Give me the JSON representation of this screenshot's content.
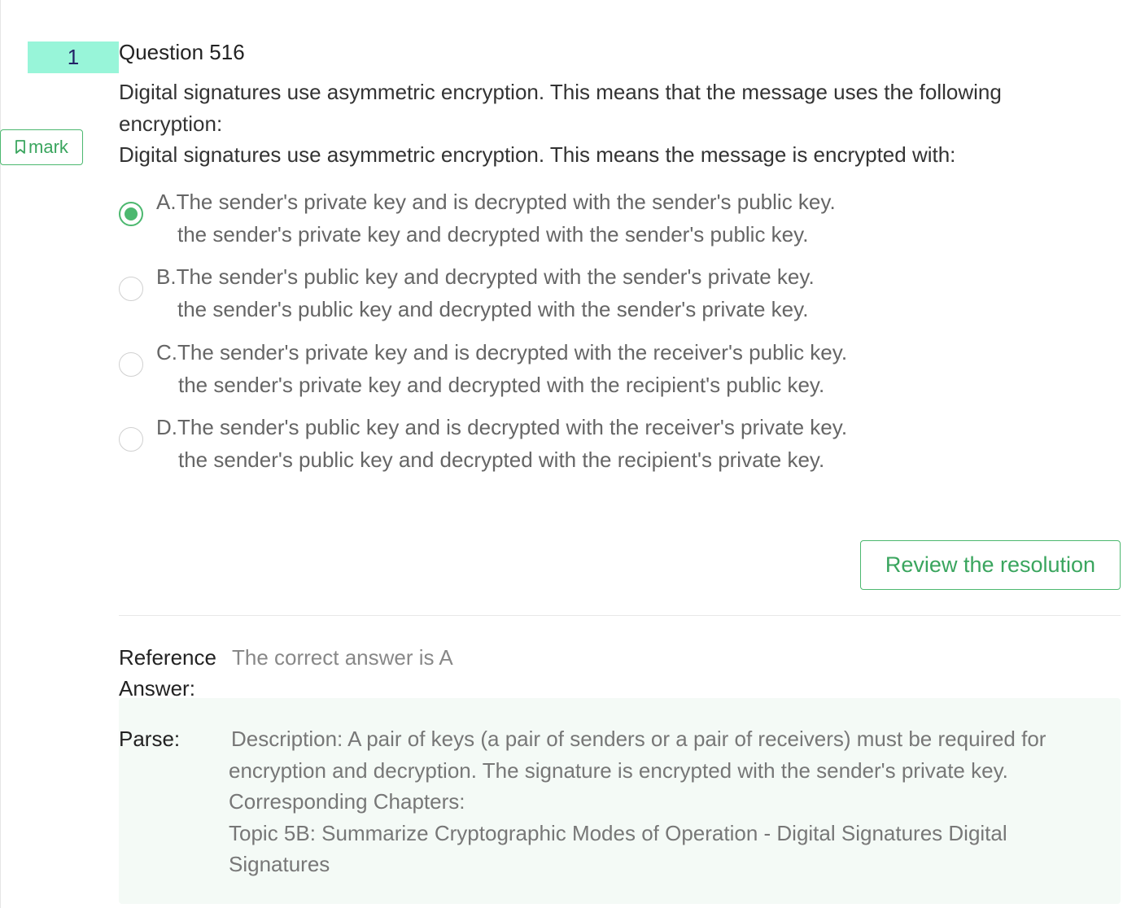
{
  "question": {
    "number": "1",
    "title": "Question 516",
    "stem_lines": [
      "Digital signatures use asymmetric encryption. This means that the message uses the following encryption:",
      "Digital signatures use asymmetric encryption. This means the message is encrypted with:"
    ]
  },
  "mark_button": {
    "label": "mark",
    "icon": "bookmark-icon"
  },
  "options": [
    {
      "letter": "A.",
      "text": "The sender's private key and is decrypted with the sender's public key.",
      "alt_text": "the sender's private key and decrypted with the sender's public key.",
      "selected": true
    },
    {
      "letter": "B.",
      "text": "The sender's public key and decrypted with the sender's private key.",
      "alt_text": "the sender's public key and decrypted with the sender's private key.",
      "selected": false
    },
    {
      "letter": "C.",
      "text": "The sender's private key and is decrypted with the receiver's public key.",
      "alt_text": "the sender's private key and decrypted with the recipient's public key.",
      "selected": false
    },
    {
      "letter": "D.",
      "text": "The sender's public key and is decrypted with the receiver's private key.",
      "alt_text": "the sender's public key and decrypted with the recipient's private key.",
      "selected": false
    }
  ],
  "review_button": {
    "label": "Review the resolution"
  },
  "reference": {
    "label_line1": "Reference",
    "label_line2": "Answer:",
    "value": "The correct answer is A"
  },
  "parse": {
    "label": "Parse:",
    "lines": [
      "Description: A pair of keys (a pair of senders or a pair of receivers) must be required for encryption and decryption. The signature is encrypted with the sender's private key.",
      "Corresponding Chapters:",
      "Topic 5B: Summarize Cryptographic Modes of Operation - Digital Signatures Digital Signatures"
    ]
  },
  "colors": {
    "accent_green": "#4cb86f",
    "number_badge_bg": "#98f5d9",
    "parse_bg": "#f4faf6"
  }
}
